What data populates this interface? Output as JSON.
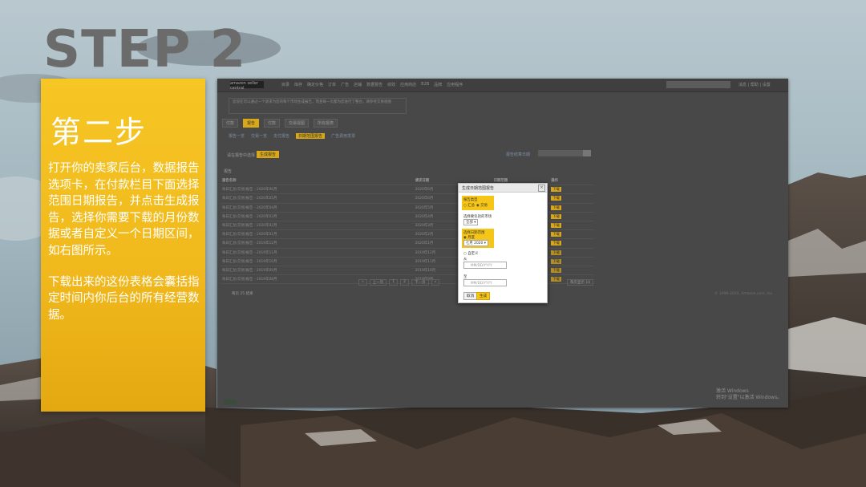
{
  "step_title": "STEP 2",
  "card": {
    "heading": "第二步",
    "paragraphs": [
      "打开你的卖家后台，数据报告选项卡，在付款栏目下面选择范围日期报告，并点击生成报告，选择你需要下载的月份数据或者自定义一个日期区间，如右图所示。",
      "下载出来的这份表格会囊括指定时间内你后台的所有经营数据。"
    ]
  },
  "colors": {
    "card_yellow": "#f0b81c",
    "highlight": "#f5c518",
    "panel_bg": "#484848",
    "title_gray": "#6b6b6b"
  },
  "screenshot": {
    "logo": "amazon seller central",
    "nav_links": [
      "目录",
      "库存",
      "确定价格",
      "订单",
      "广告",
      "店铺",
      "数据报告",
      "绩效",
      "应用商店",
      "B2B",
      "品牌",
      "应用程序"
    ],
    "nav_right": "消息 | 帮助 | 设置",
    "notice": "您现在可以通过一个请求为您的每个市场生成报告，而且每一页都为您进行了整合，请参考交易视图",
    "tabs": [
      "付款",
      "报告",
      "付款",
      "交易视图",
      "所有报表",
      "资金数据"
    ],
    "active_tab_index": 1,
    "subtabs": [
      "报告一览",
      "交易一览",
      "支付报告",
      "日期范围报告",
      "广告费用发票"
    ],
    "active_subtab_index": 3,
    "filter_label": "请在报告中选择",
    "filter_button": "生成报告",
    "right_search_label": "报告结算日期",
    "report_head": "报告",
    "table": {
      "headers": [
        "报告名称",
        "请求日期",
        "日期范围",
        "操作"
      ],
      "rows": [
        [
          "每日汇总(交易)报告 - 2020年06月",
          "2020年6月",
          "",
          "下载"
        ],
        [
          "每日汇总(交易)报告 - 2020年05月",
          "2020年6月",
          "",
          "下载"
        ],
        [
          "每日汇总(交易)报告 - 2020年04月",
          "2020年5月",
          "",
          "下载"
        ],
        [
          "每日汇总(交易)报告 - 2020年03月",
          "2020年4月",
          "",
          "下载"
        ],
        [
          "每日汇总(交易)报告 - 2020年02月",
          "2020年3月",
          "",
          "下载"
        ],
        [
          "每日汇总(交易)报告 - 2020年01月",
          "2020年2月",
          "",
          "下载"
        ],
        [
          "每日汇总(交易)报告 - 2019年12月",
          "2020年1月",
          "",
          "下载"
        ],
        [
          "每日汇总(交易)报告 - 2019年11月",
          "2019年12月",
          "",
          "下载"
        ],
        [
          "每日汇总(交易)报告 - 2019年10月",
          "2019年11月",
          "",
          "下载"
        ],
        [
          "每日汇总(交易)报告 - 2019年09月",
          "2019年10月",
          "",
          "下载"
        ],
        [
          "每日汇总(交易)报告 - 2019年08月",
          "2019年9月",
          "",
          "下载"
        ]
      ]
    },
    "pager": [
      "«",
      "上一页",
      "1",
      "2",
      "下一页",
      "»"
    ],
    "pager_right": "每页显示 10",
    "per_page": "每页   25 结果",
    "footer_text": "© 1999-2020, Amazon.com, Inc.",
    "activate_windows": [
      "激活 Windows",
      "转到\"设置\"以激活 Windows。"
    ],
    "dialog": {
      "title": "生成日期范围报告",
      "close": "×",
      "report_type_label": "报告类型",
      "report_type_options": [
        "汇总",
        "交易"
      ],
      "marketplace_label": "选择要包括的市场",
      "marketplace_value": "全部",
      "date_range_label": "选择日期范围",
      "range_option": "月度",
      "month_value": "七月 2020",
      "custom_option": "自定义",
      "from_label": "从",
      "from_placeholder": "MM/DD/YYYY",
      "to_label": "至",
      "to_placeholder": "MM/DD/YYYY",
      "cancel": "取消",
      "submit": "生成"
    }
  }
}
